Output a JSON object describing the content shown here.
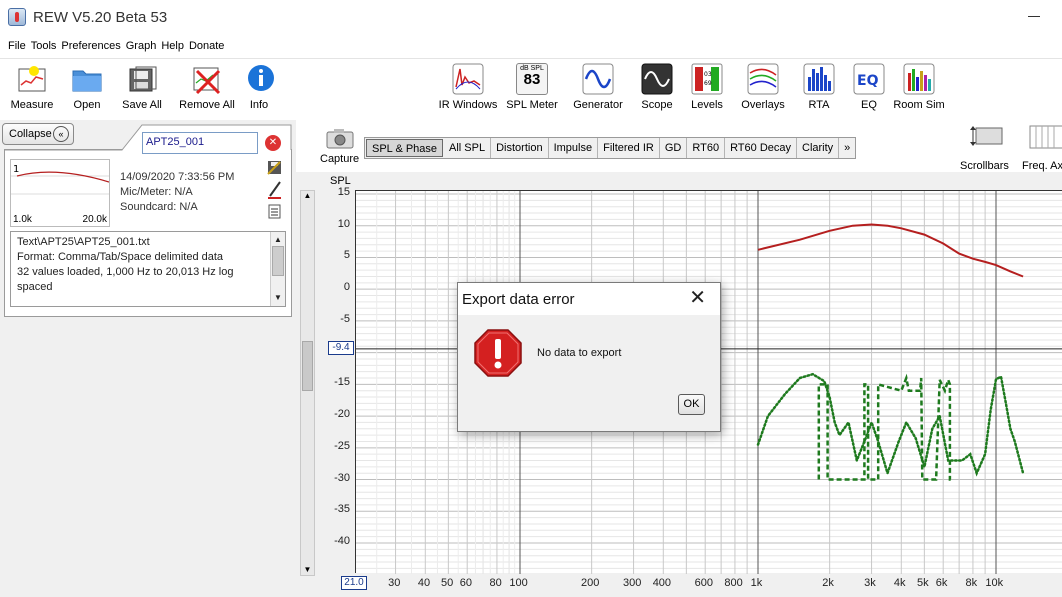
{
  "window": {
    "title": "REW V5.20 Beta 53"
  },
  "menu": [
    "File",
    "Tools",
    "Preferences",
    "Graph",
    "Help",
    "Donate"
  ],
  "toolbar_left": [
    {
      "label": "Measure",
      "icon": "measure-icon"
    },
    {
      "label": "Open",
      "icon": "folder-open-icon"
    },
    {
      "label": "Save All",
      "icon": "save-all-icon"
    },
    {
      "label": "Remove All",
      "icon": "remove-all-icon"
    },
    {
      "label": "Info",
      "icon": "info-icon"
    }
  ],
  "toolbar_right": [
    {
      "label": "IR Windows",
      "icon": "ir-windows-icon"
    },
    {
      "label": "SPL Meter",
      "icon": "spl-meter-icon",
      "display_top": "dB SPL",
      "display_value": "83"
    },
    {
      "label": "Generator",
      "icon": "generator-icon"
    },
    {
      "label": "Scope",
      "icon": "scope-icon"
    },
    {
      "label": "Levels",
      "icon": "levels-icon"
    },
    {
      "label": "Overlays",
      "icon": "overlays-icon"
    },
    {
      "label": "RTA",
      "icon": "rta-icon"
    },
    {
      "label": "EQ",
      "icon": "eq-icon"
    },
    {
      "label": "Room Sim",
      "icon": "room-sim-icon"
    }
  ],
  "left_panel": {
    "collapse_label": "Collapse",
    "measurement_name": "APT25_001",
    "measurement_index": "1",
    "thumb_x_start": "1.0k",
    "thumb_x_end": "20.0k",
    "date": "14/09/2020 7:33:56 PM",
    "mic_meter": "Mic/Meter: N/A",
    "soundcard": "Soundcard: N/A",
    "notes": [
      "Text\\APT25\\APT25_001.txt",
      "Format: Comma/Tab/Space delimited data",
      "32 values loaded, 1,000 Hz to 20,013 Hz log",
      "spaced"
    ]
  },
  "graph": {
    "capture_label": "Capture",
    "tabs": [
      "SPL & Phase",
      "All SPL",
      "Distortion",
      "Impulse",
      "Filtered IR",
      "GD",
      "RT60",
      "RT60 Decay",
      "Clarity",
      "»"
    ],
    "active_tab": "SPL & Phase",
    "right_tools": [
      "Scrollbars",
      "Freq. Ax"
    ],
    "y_axis_title": "SPL",
    "y_marker": "-9.4",
    "x_marker": "21.0"
  },
  "chart_data": {
    "type": "line",
    "y_ticks": [
      "15",
      "10",
      "5",
      "0",
      "-5",
      "-10",
      "-15",
      "-20",
      "-25",
      "-30",
      "-35",
      "-40"
    ],
    "x_ticks": [
      "30",
      "40",
      "50",
      "60",
      "80",
      "100",
      "200",
      "300",
      "400",
      "600",
      "800",
      "1k",
      "2k",
      "3k",
      "4k",
      "5k",
      "6k",
      "8k",
      "10k"
    ],
    "ylim": [
      -45,
      16
    ],
    "x_scale": "log",
    "series": [
      {
        "style": "solid-red",
        "color": "#b51f1f",
        "x": [
          1000,
          1500,
          2000,
          2500,
          3000,
          3500,
          4000,
          5000,
          6000,
          7000,
          8000,
          9000,
          10000,
          11500,
          13000
        ],
        "y": [
          6.2,
          7.8,
          9.2,
          10.0,
          10.2,
          10.0,
          9.6,
          8.6,
          7.2,
          5.6,
          4.8,
          4.3,
          3.8,
          2.8,
          2.0
        ]
      },
      {
        "style": "dotted-green",
        "color": "#1e7a1e",
        "x": [
          1000,
          1100,
          1300,
          1500,
          1700,
          1900,
          2000,
          2100,
          2200,
          2400,
          2600,
          2800,
          3000,
          3200,
          3500,
          3900,
          4200,
          4600,
          5000,
          5400,
          5800,
          6300,
          6800,
          7200,
          7800,
          8300,
          9000,
          9500,
          10000,
          10500,
          11000,
          11500,
          12000,
          13000
        ],
        "y": [
          -24.5,
          -20,
          -16.5,
          -14,
          -13.4,
          -14.5,
          -17,
          -21,
          -23,
          -21,
          -27,
          -24,
          -21,
          -24,
          -29,
          -24,
          -21,
          -23.5,
          -28,
          -22,
          -20,
          -27,
          -27,
          -27,
          -26,
          -29,
          -26,
          -19,
          -14.2,
          -13.8,
          -18,
          -22,
          -24,
          -29
        ]
      },
      {
        "style": "dashed-green",
        "color": "#1e7a1e",
        "x": [
          1800,
          1800,
          1810,
          1950,
          1960,
          1960,
          2800,
          2800,
          2850,
          2900,
          2900,
          3200,
          3200,
          4000,
          4200,
          4300,
          4800,
          4850,
          4900,
          5600,
          5800,
          6100,
          6300,
          6400,
          6400,
          6450
        ],
        "y": [
          -30,
          -15,
          -15,
          -15,
          -15,
          -30,
          -30,
          -15,
          -15,
          -15,
          -30,
          -30,
          -15,
          -16,
          -14,
          -16,
          -16,
          -14,
          -30,
          -30,
          -14.3,
          -16,
          -14.3,
          -15,
          -30,
          -30
        ]
      }
    ]
  },
  "dialog": {
    "title": "Export data error",
    "message": "No data to export",
    "ok_label": "OK"
  },
  "colors": {
    "accent_blue": "#1a3b8c",
    "error_red": "#d42020",
    "spl_red": "#b51f1f",
    "phase_green": "#1e7a1e"
  }
}
